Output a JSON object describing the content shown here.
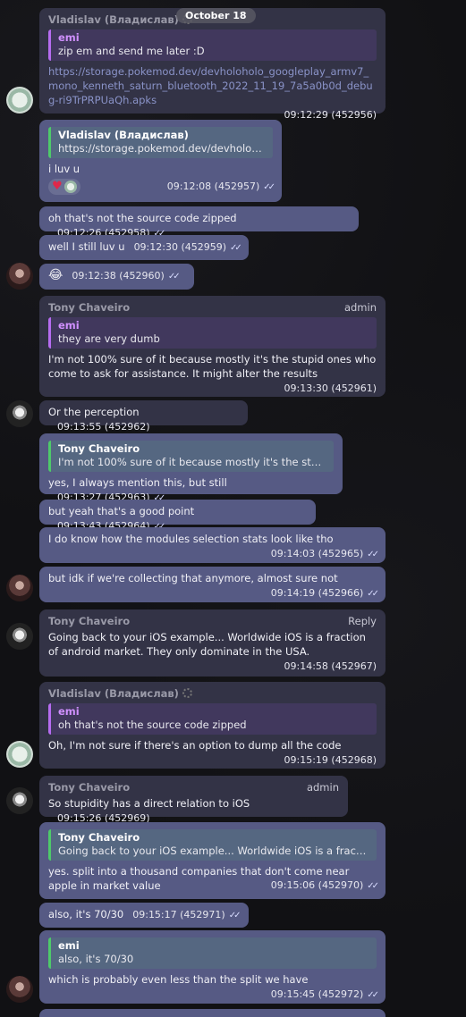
{
  "date_separator": "October 18",
  "messages": [
    {
      "sender": "Vladislav (Владислав)",
      "quote_name": "emi",
      "quote_text": "zip em and send me later :D",
      "link": "https://storage.pokemod.dev/devholoholo_googleplay_armv7_mono_kenneth_saturn_bluetooth_2022_11_19_7a5a0b0d_debug-ri9TrPRPUaQh.apks",
      "time": "09:12:29",
      "id": "(452956)"
    },
    {
      "quote_name": "Vladislav (Владислав)",
      "quote_text": "https://storage.pokemod.dev/devholohol...",
      "text": "i luv u",
      "time": "09:12:08",
      "id": "(452957)"
    },
    {
      "text": "oh that's not the source code zipped",
      "time": "09:12:26",
      "id": "(452958)"
    },
    {
      "text": "well I still luv u",
      "time": "09:12:30",
      "id": "(452959)"
    },
    {
      "text": "😂",
      "time": "09:12:38",
      "id": "(452960)"
    },
    {
      "sender": "Tony Chaveiro",
      "role": "admin",
      "quote_name": "emi",
      "quote_text": "they are very dumb",
      "text": "I'm not 100% sure of it because mostly it's the stupid ones who come to ask for assistance. It might alter the results",
      "time": "09:13:30",
      "id": "(452961)"
    },
    {
      "text": "Or the perception",
      "time": "09:13:55",
      "id": "(452962)"
    },
    {
      "quote_name": "Tony Chaveiro",
      "quote_text": "I'm not 100% sure of it because mostly it's the stupid ...",
      "text": "yes, I always mention this, but still",
      "time": "09:13:27",
      "id": "(452963)"
    },
    {
      "text": "but yeah that's a good point",
      "time": "09:13:43",
      "id": "(452964)"
    },
    {
      "text": "I do know how the modules selection stats look like tho",
      "time": "09:14:03",
      "id": "(452965)"
    },
    {
      "text": "but idk if we're collecting that anymore, almost sure not",
      "time": "09:14:19",
      "id": "(452966)"
    },
    {
      "sender": "Tony Chaveiro",
      "role": "Reply",
      "text": "Going back to your iOS example... Worldwide iOS is a fraction of android market. They only dominate in the USA.",
      "time": "09:14:58",
      "id": "(452967)"
    },
    {
      "sender": "Vladislav (Владислав)",
      "quote_name": "emi",
      "quote_text": "oh that's not the source code zipped",
      "text": "Oh, I'm not sure if there's an option to dump all the code",
      "time": "09:15:19",
      "id": "(452968)"
    },
    {
      "sender": "Tony Chaveiro",
      "role": "admin",
      "text": "So stupidity has a direct relation to iOS",
      "time": "09:15:26",
      "id": "(452969)"
    },
    {
      "quote_name": "Tony Chaveiro",
      "quote_text": "Going back to your iOS example... Worldwide iOS is a fraction o...",
      "text": "yes. split into a thousand companies that don't come near apple in market value",
      "time": "09:15:06",
      "id": "(452970)"
    },
    {
      "text": "also, it's 70/30",
      "time": "09:15:17",
      "id": "(452971)"
    },
    {
      "quote_name": "emi",
      "quote_text": "also, it's 70/30",
      "text": "which is probably even less than the split we have",
      "time": "09:15:45",
      "id": "(452972)"
    }
  ],
  "colors": {
    "outgoing": "#565a84",
    "incoming": "#2b2b38",
    "accent_green": "#4ec96a",
    "accent_purple": "#b66cf0"
  }
}
